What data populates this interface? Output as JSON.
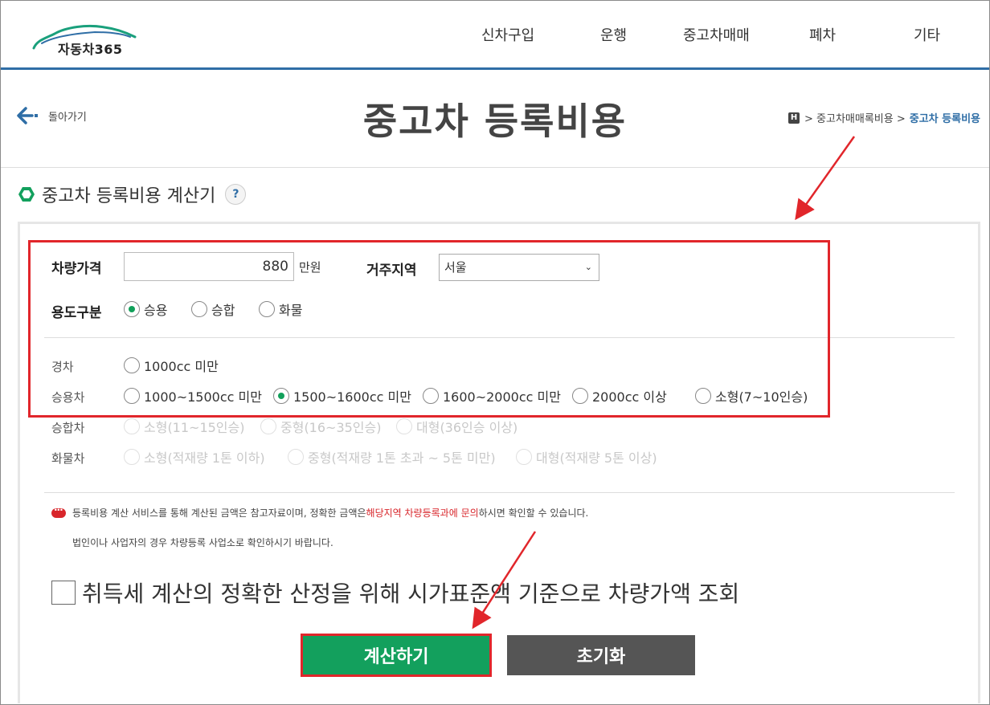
{
  "header": {
    "logo_text": "자동차365",
    "nav": [
      "신차구입",
      "운행",
      "중고차매매",
      "폐차",
      "기타"
    ]
  },
  "titlebar": {
    "back_label": "돌아가기",
    "title": "중고차 등록비용",
    "breadcrumb": {
      "home": "H",
      "parent": "> 중고차매매록비용 >",
      "current": "중고차 등록비용"
    }
  },
  "section": {
    "title": "중고차 등록비용 계산기",
    "help": "?"
  },
  "form": {
    "price_label": "차량가격",
    "price_value": "880",
    "price_unit": "만원",
    "region_label": "거주지역",
    "region_value": "서울",
    "usage_label": "용도구분",
    "usage_options": [
      "승용",
      "승합",
      "화물"
    ],
    "usage_selected": "승용",
    "categories": {
      "light": {
        "label": "경차",
        "options": [
          "1000cc 미만"
        ]
      },
      "passenger": {
        "label": "승용차",
        "options": [
          "1000~1500cc 미만",
          "1500~1600cc 미만",
          "1600~2000cc 미만",
          "2000cc 이상",
          "소형(7~10인승)"
        ],
        "selected": "1500~1600cc 미만"
      },
      "van": {
        "label": "승합차",
        "options": [
          "소형(11~15인승)",
          "중형(16~35인승)",
          "대형(36인승 이상)"
        ]
      },
      "truck": {
        "label": "화물차",
        "options": [
          "소형(적재량 1톤 이하)",
          "중형(적재량 1톤 초과 ~ 5톤 미만)",
          "대형(적재량 5톤 이상)"
        ]
      }
    }
  },
  "notice": {
    "line1_pre": "등록비용 계산 서비스를 통해 계산된 금액은 참고자료이며, 정확한 금액은 ",
    "line1_red": "해당지역 차량등록과에 문의",
    "line1_post": "하시면 확인할 수 있습니다.",
    "line2": "법인이나 사업자의 경우 차량등록 사업소로 확인하시기 바랍니다."
  },
  "checkbox_label": "취득세 계산의 정확한 산정을 위해 시가표준액 기준으로 차량가액 조회",
  "buttons": {
    "calculate": "계산하기",
    "reset": "초기화"
  },
  "colors": {
    "accent_blue": "#2f6ea6",
    "green": "#13a05d",
    "annotation_red": "#e1262b",
    "reset_gray": "#555555"
  }
}
